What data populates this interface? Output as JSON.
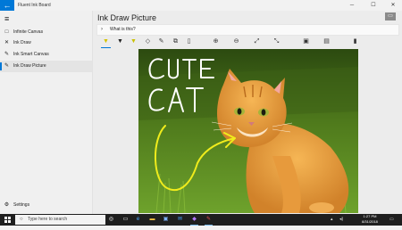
{
  "window": {
    "title": "Fluent Ink Board",
    "back_glyph": "←",
    "minimize_glyph": "─",
    "maximize_glyph": "☐",
    "close_glyph": "✕"
  },
  "sidebar": {
    "menu_glyph": "≡",
    "items": [
      {
        "label": "Infinite Canvas",
        "icon": "infinite-canvas-icon",
        "glyph": "□"
      },
      {
        "label": "Ink Draw",
        "icon": "ink-draw-icon",
        "glyph": "✕"
      },
      {
        "label": "Ink Smart Canvas",
        "icon": "ink-smart-icon",
        "glyph": "✎"
      },
      {
        "label": "Ink Draw Picture",
        "icon": "ink-picture-icon",
        "glyph": "✎"
      }
    ],
    "settings": {
      "label": "Settings",
      "glyph": "⚙"
    }
  },
  "main": {
    "title": "Ink Draw Picture",
    "question": {
      "chevron": "›",
      "text": "What is this?"
    },
    "header_button_glyph": "▭",
    "tools": [
      {
        "name": "ballpoint-pen",
        "glyph": "▼",
        "color": "#d4c200"
      },
      {
        "name": "pencil",
        "glyph": "▼",
        "color": "#222222"
      },
      {
        "name": "highlighter",
        "glyph": "▼",
        "color": "#c9c000"
      },
      {
        "name": "eraser",
        "glyph": "◇",
        "color": "#333333"
      },
      {
        "name": "ruler",
        "glyph": "✎",
        "color": "#333333"
      },
      {
        "name": "lasso",
        "glyph": "⧉",
        "color": "#333333"
      },
      {
        "name": "clear",
        "glyph": "▯",
        "color": "#333333"
      },
      {
        "name": "zoom-in",
        "glyph": "⊕",
        "color": "#333333"
      },
      {
        "name": "zoom-out",
        "glyph": "⊖",
        "color": "#333333"
      },
      {
        "name": "fit",
        "glyph": "⤢",
        "color": "#333333"
      },
      {
        "name": "reset",
        "glyph": "⤡",
        "color": "#333333"
      },
      {
        "name": "open-image",
        "glyph": "▣",
        "color": "#333333"
      },
      {
        "name": "save",
        "glyph": "▤",
        "color": "#333333"
      },
      {
        "name": "delete",
        "glyph": "▮",
        "color": "#333333"
      }
    ],
    "canvas": {
      "ink_text_line1": "CUTE",
      "ink_text_line2": "CAT"
    }
  },
  "taskbar": {
    "search_placeholder": "Type here to search",
    "clock_time": "1:27 PM",
    "clock_date": "8/31/2018",
    "apps": [
      {
        "name": "mic",
        "glyph": "◎"
      },
      {
        "name": "task-view",
        "glyph": "▭"
      },
      {
        "name": "edge",
        "glyph": "e"
      },
      {
        "name": "file-explorer",
        "glyph": "▬"
      },
      {
        "name": "store",
        "glyph": "▣"
      },
      {
        "name": "mail",
        "glyph": "✉"
      },
      {
        "name": "visual-studio",
        "glyph": "◆"
      },
      {
        "name": "ink-board",
        "glyph": "✎"
      }
    ]
  },
  "colors": {
    "accent": "#0078d7",
    "ink_yellow": "#f0ec1c",
    "ink_white": "#ffffff"
  }
}
